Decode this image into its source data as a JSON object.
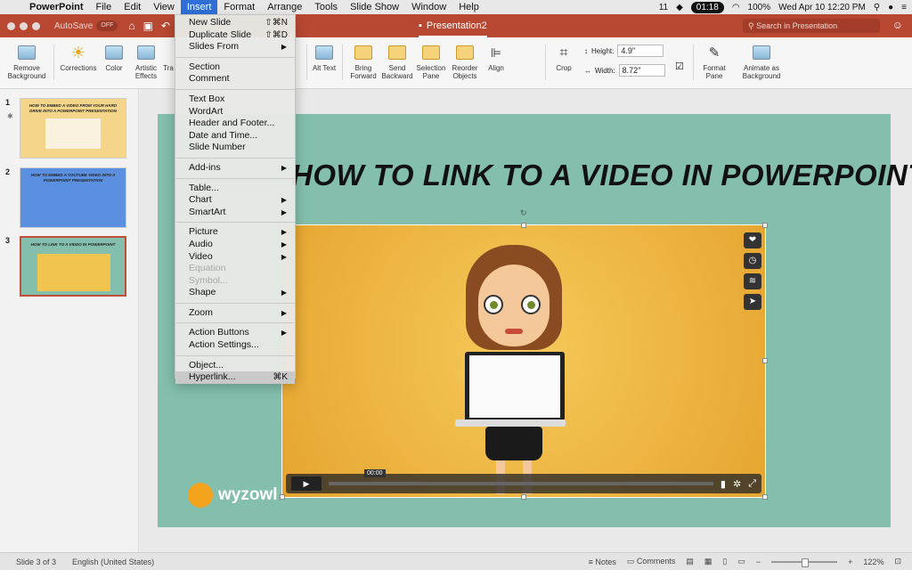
{
  "menubar": {
    "app": "PowerPoint",
    "items": [
      "File",
      "Edit",
      "View",
      "Insert",
      "Format",
      "Arrange",
      "Tools",
      "Slide Show",
      "Window",
      "Help"
    ],
    "active": "Insert",
    "badge": "11",
    "clock": "01:18",
    "battery": "100%",
    "datetime": "Wed Apr 10  12:20 PM"
  },
  "titlebar": {
    "autosave": "AutoSave",
    "autosave_state": "OFF",
    "doc_title": "Presentation2",
    "search_placeholder": "Search in Presentation"
  },
  "ribbon": {
    "remove_bg": "Remove Background",
    "corrections": "Corrections",
    "color": "Color",
    "artistic": "Artistic Effects",
    "transparency": "Tra",
    "alt_text": "Alt Text",
    "bring_forward": "Bring Forward",
    "send_backward": "Send Backward",
    "selection_pane": "Selection Pane",
    "reorder": "Reorder Objects",
    "align": "Align",
    "crop": "Crop",
    "height_label": "Height:",
    "height_value": "4.9\"",
    "width_label": "Width:",
    "width_value": "8.72\"",
    "format_pane": "Format Pane",
    "animate_bg": "Animate as Background"
  },
  "thumbnails": [
    {
      "num": "1",
      "title": "HOW TO EMBED A VIDEO FROM YOUR HARD DRIVE INTO A POWERPOINT PRESENTATION",
      "bg": "#f4d58a"
    },
    {
      "num": "2",
      "title": "HOW TO EMBED A YOUTUBE VIDEO INTO A POWERPOINT PRESENTATION",
      "bg": "#5b8fe0"
    },
    {
      "num": "3",
      "title": "HOW TO LINK TO A VIDEO IN POWERPOINT",
      "bg": "#84bfad"
    }
  ],
  "slide": {
    "title": "HOW TO LINK TO A VIDEO IN POWERPOINT",
    "video_time": "00:00",
    "logo": "wyzowl"
  },
  "insert_menu": {
    "new_slide": "New Slide",
    "new_slide_sc": "⇧⌘N",
    "duplicate_slide": "Duplicate Slide",
    "duplicate_slide_sc": "⇧⌘D",
    "slides_from": "Slides From",
    "section": "Section",
    "comment": "Comment",
    "text_box": "Text Box",
    "wordart": "WordArt",
    "header_footer": "Header and Footer...",
    "date_time": "Date and Time...",
    "slide_number": "Slide Number",
    "add_ins": "Add-ins",
    "table": "Table...",
    "chart": "Chart",
    "smartart": "SmartArt",
    "picture": "Picture",
    "audio": "Audio",
    "video": "Video",
    "equation": "Equation",
    "symbol": "Symbol...",
    "shape": "Shape",
    "zoom": "Zoom",
    "action_buttons": "Action Buttons",
    "action_settings": "Action Settings...",
    "object": "Object...",
    "hyperlink": "Hyperlink...",
    "hyperlink_sc": "⌘K"
  },
  "statusbar": {
    "slide_info": "Slide 3 of 3",
    "language": "English (United States)",
    "notes": "Notes",
    "comments": "Comments",
    "zoom": "122%"
  }
}
